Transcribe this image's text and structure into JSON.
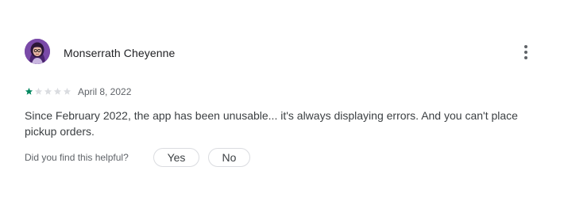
{
  "review": {
    "reviewer_name": "Monserrath Cheyenne",
    "rating": 1,
    "rating_max": 5,
    "date": "April 8, 2022",
    "text": "Since February 2022, the app has been unusable... it's always displaying errors. And you can't place pickup orders.",
    "helpful_question": "Did you find this helpful?",
    "yes_label": "Yes",
    "no_label": "No"
  },
  "icons": {
    "menu": "more-vert-icon",
    "star": "star-icon"
  },
  "colors": {
    "star_filled": "#01875f",
    "star_empty": "#dadce0",
    "avatar_bg": "#7a4aa8"
  }
}
